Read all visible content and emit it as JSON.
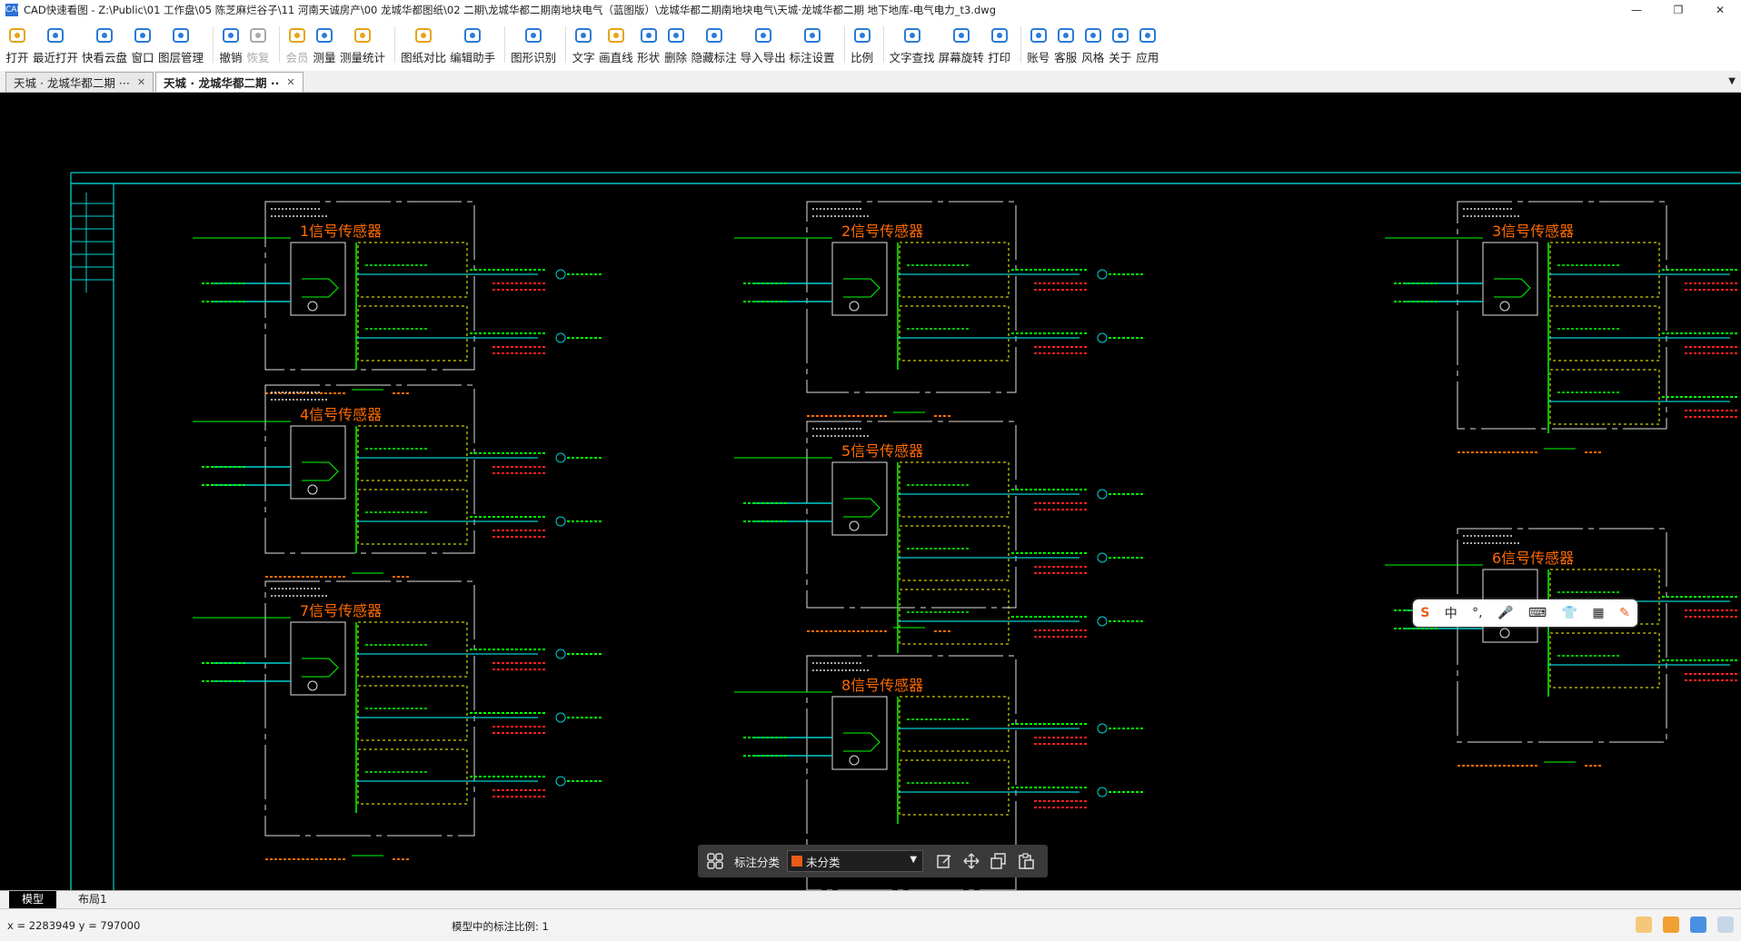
{
  "window": {
    "app_icon": "CAD",
    "title": "CAD快速看图 - Z:\\Public\\01 工作盘\\05 陈芝麻烂谷子\\11 河南天诚房产\\00 龙城华都图纸\\02 二期\\龙城华都二期南地块电气（蓝图版）\\龙城华都二期南地块电气\\天城·龙城华都二期 地下地库-电气电力_t3.dwg",
    "minimize": "—",
    "maximize": "❐",
    "close": "✕"
  },
  "toolbar": [
    {
      "name": "open",
      "label": "打开",
      "icon": "folder-icon",
      "color": "#e8a317"
    },
    {
      "name": "recent",
      "label": "最近打开",
      "icon": "clock-icon",
      "color": "#2a7bd8"
    },
    {
      "name": "cloud",
      "label": "快看云盘",
      "icon": "cloud-icon",
      "color": "#2a7bd8"
    },
    {
      "name": "window",
      "label": "窗口",
      "icon": "window-icon",
      "color": "#2a7bd8"
    },
    {
      "name": "layers",
      "label": "图层管理",
      "icon": "layers-icon",
      "color": "#2a7bd8"
    },
    {
      "name": "undo",
      "label": "撤销",
      "icon": "undo-icon",
      "color": "#2a7bd8"
    },
    {
      "name": "redo",
      "label": "恢复",
      "icon": "redo-icon",
      "color": "#aaa",
      "disabled": true
    },
    {
      "name": "vip",
      "label": "会员",
      "icon": "vip-icon",
      "color": "#e8a317",
      "disabled": true
    },
    {
      "name": "measure",
      "label": "测量",
      "icon": "ruler-icon",
      "color": "#2a7bd8"
    },
    {
      "name": "measure-stats",
      "label": "测量统计",
      "icon": "stats-icon",
      "color": "#e8a317"
    },
    {
      "name": "compare",
      "label": "图纸对比",
      "icon": "compare-icon",
      "color": "#e8a317"
    },
    {
      "name": "edit-helper",
      "label": "编辑助手",
      "icon": "edit-helper-icon",
      "color": "#2a7bd8"
    },
    {
      "name": "shape-recog",
      "label": "图形识别",
      "icon": "shape-recog-icon",
      "color": "#2a7bd8"
    },
    {
      "name": "text",
      "label": "文字",
      "icon": "text-icon",
      "color": "#2a7bd8"
    },
    {
      "name": "line",
      "label": "画直线",
      "icon": "line-icon",
      "color": "#e8a317"
    },
    {
      "name": "shape",
      "label": "形状",
      "icon": "shape-icon",
      "color": "#2a7bd8"
    },
    {
      "name": "delete",
      "label": "删除",
      "icon": "eraser-icon",
      "color": "#2a7bd8"
    },
    {
      "name": "hide-anno",
      "label": "隐藏标注",
      "icon": "eye-icon",
      "color": "#2a7bd8"
    },
    {
      "name": "import-export",
      "label": "导入导出",
      "icon": "export-icon",
      "color": "#2a7bd8"
    },
    {
      "name": "anno-settings",
      "label": "标注设置",
      "icon": "anno-settings-icon",
      "color": "#2a7bd8"
    },
    {
      "name": "scale",
      "label": "比例",
      "icon": "scale-icon",
      "color": "#2a7bd8"
    },
    {
      "name": "text-search",
      "label": "文字查找",
      "icon": "search-icon",
      "color": "#2a7bd8"
    },
    {
      "name": "rotate",
      "label": "屏幕旋转",
      "icon": "rotate-icon",
      "color": "#2a7bd8"
    },
    {
      "name": "print",
      "label": "打印",
      "icon": "print-icon",
      "color": "#2a7bd8"
    },
    {
      "name": "account",
      "label": "账号",
      "icon": "user-icon",
      "color": "#2a7bd8"
    },
    {
      "name": "service",
      "label": "客服",
      "icon": "headset-icon",
      "color": "#2a7bd8"
    },
    {
      "name": "style",
      "label": "风格",
      "icon": "style-icon",
      "color": "#2a7bd8"
    },
    {
      "name": "about",
      "label": "关于",
      "icon": "info-icon",
      "color": "#2a7bd8"
    },
    {
      "name": "apps",
      "label": "应用",
      "icon": "cube-icon",
      "color": "#2a7bd8"
    }
  ],
  "tabs": [
    {
      "label": "天城 · 龙城华都二期 ···",
      "active": false,
      "close": "✕"
    },
    {
      "label": "天城 · 龙城华都二期 ··",
      "active": true,
      "close": "✕"
    }
  ],
  "tabbar_more": "▼",
  "drawing": {
    "titles": [
      "1信号传感器",
      "2信号传感器",
      "3信号传感器",
      "4信号传感器",
      "5信号传感器",
      "6信号传感器",
      "7信号传感器",
      "8信号传感器"
    ],
    "colors": {
      "frame": "#00d0d0",
      "text_green": "#00ff00",
      "text_orange": "#ff6a00",
      "red": "#ff2020",
      "yellow": "#ffff00",
      "white": "#e0e0e0",
      "magenta": "#ff00ff"
    }
  },
  "layout_tabs": {
    "model": "模型",
    "layout1": "布局1"
  },
  "annotation_bar": {
    "label": "标注分类",
    "selected": "未分类",
    "arrow": "▼"
  },
  "ime": {
    "items": [
      "S",
      "中",
      "°,",
      "🎤",
      "⌨",
      "👕",
      "▦",
      "✎"
    ]
  },
  "status": {
    "coords": "x = 2283949  y = 797000",
    "scale": "模型中的标注比例: 1"
  }
}
